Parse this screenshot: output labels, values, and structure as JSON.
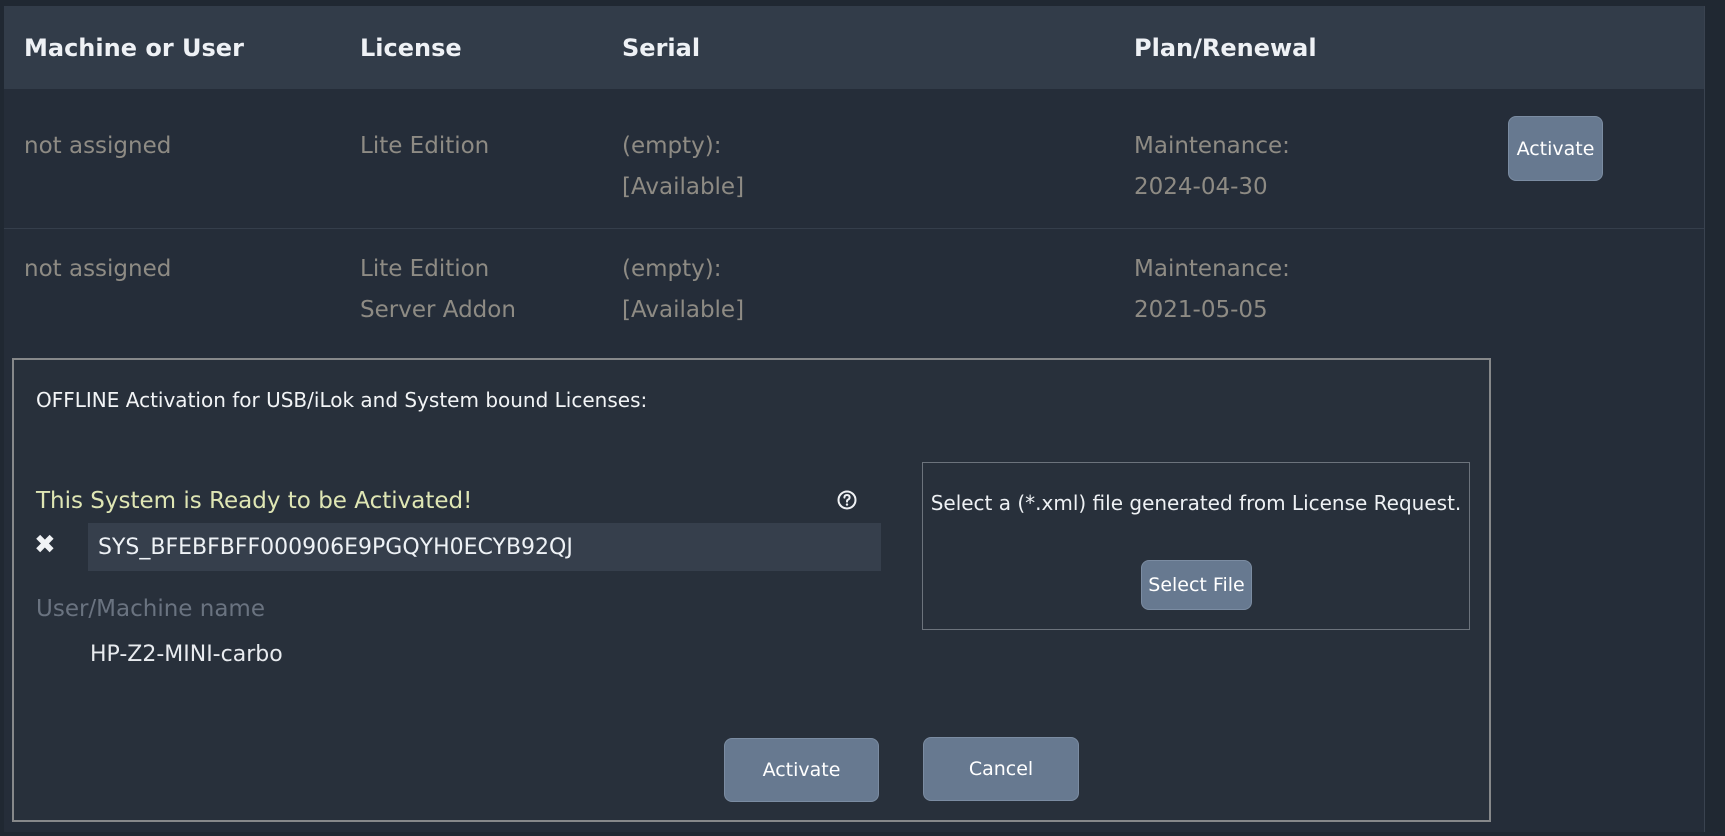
{
  "table": {
    "headers": {
      "machine": "Machine or User",
      "license": "License",
      "serial": "Serial",
      "plan": "Plan/Renewal"
    },
    "rows": [
      {
        "machine": "not assigned",
        "license": [
          "Lite Edition"
        ],
        "serial": [
          "(empty):",
          "[Available]"
        ],
        "plan": [
          "Maintenance:",
          "2024-04-30"
        ],
        "action_label": "Activate"
      },
      {
        "machine": "not assigned",
        "license": [
          "Lite Edition",
          "Server Addon"
        ],
        "serial": [
          "(empty):",
          "[Available]"
        ],
        "plan": [
          "Maintenance:",
          "2021-05-05"
        ]
      }
    ]
  },
  "dialog": {
    "title": "OFFLINE Activation for USB/iLok and System bound Licenses:",
    "status": "This System is Ready to be Activated!",
    "status_color": "#dfe6b4",
    "help_icon": "question-circle-icon",
    "clear_icon": "close-x-icon",
    "serial_value": "SYS_BFEBFBFF000906E9PGQYH0ECYB92QJ",
    "name_label": "User/Machine name",
    "machine_name": "HP-Z2-MINI-carbo",
    "file_prompt": "Select a (*.xml) file generated from License Request.",
    "select_file_label": "Select File",
    "activate_label": "Activate",
    "cancel_label": "Cancel"
  },
  "colors": {
    "background": "#252d39",
    "header": "#323c49",
    "button": "#677990",
    "muted_text": "#8e8b84"
  }
}
